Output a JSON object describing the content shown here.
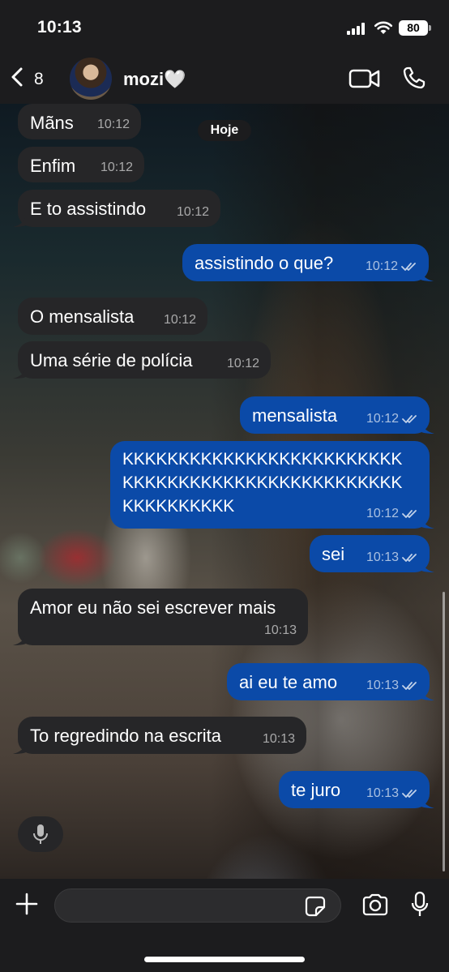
{
  "status_bar": {
    "time": "10:13",
    "battery": "80"
  },
  "header": {
    "back_count": "8",
    "contact_name": "mozi🤍"
  },
  "date_label": "Hoje",
  "messages": [
    {
      "dir": "in",
      "text": "Mãns",
      "time": "10:12"
    },
    {
      "dir": "in",
      "text": "Enfim",
      "time": "10:12"
    },
    {
      "dir": "in",
      "text": "E to assistindo",
      "time": "10:12"
    },
    {
      "dir": "out",
      "text": "assistindo o que?",
      "time": "10:12"
    },
    {
      "dir": "in",
      "text": "O mensalista",
      "time": "10:12"
    },
    {
      "dir": "in",
      "text": "Uma série de polícia",
      "time": "10:12"
    },
    {
      "dir": "out",
      "text": "mensalista",
      "time": "10:12"
    },
    {
      "dir": "out",
      "lines": [
        "KKKKKKKKKKKKKKKKKKKKKKKKK",
        "KKKKKKKKKKKKKKKKKKKKKKKKK",
        "KKKKKKKKKK"
      ],
      "time": "10:12"
    },
    {
      "dir": "out",
      "text": "sei",
      "time": "10:13"
    },
    {
      "dir": "in",
      "text": "Amor eu não sei escrever mais",
      "time": "10:13"
    },
    {
      "dir": "out",
      "text": "ai eu te amo",
      "time": "10:13"
    },
    {
      "dir": "in",
      "text": "To regredindo na escrita",
      "time": "10:13"
    },
    {
      "dir": "out",
      "text": "te juro",
      "time": "10:13"
    }
  ],
  "composer": {
    "value": "",
    "placeholder": ""
  },
  "icons": {
    "back": "chevron-left-icon",
    "video": "video-camera-icon",
    "phone": "phone-icon",
    "plus": "plus-icon",
    "sticker": "sticker-icon",
    "camera": "camera-icon",
    "mic": "microphone-icon"
  },
  "colors": {
    "outgoing_bubble": "#0b4aa8",
    "incoming_bubble": "#262628",
    "bar_background": "#1c1c1e"
  }
}
